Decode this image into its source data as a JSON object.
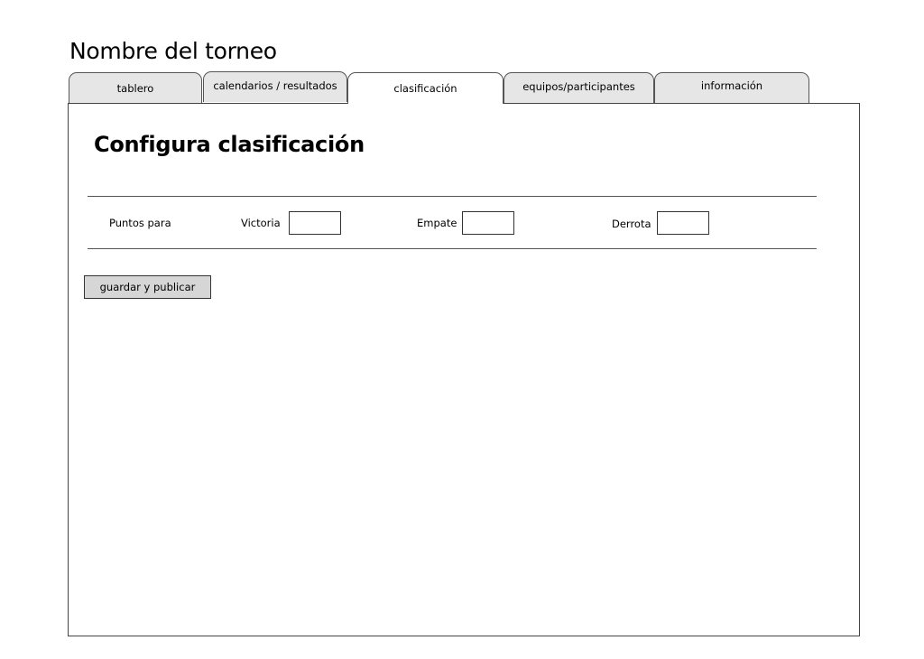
{
  "header": {
    "title": "Nombre del torneo"
  },
  "tabs": [
    {
      "label": "tablero",
      "active": false
    },
    {
      "label": "calendarios / resultados",
      "active": false
    },
    {
      "label": "clasificación",
      "active": true
    },
    {
      "label": "equipos/participantes",
      "active": false
    },
    {
      "label": "información",
      "active": false
    }
  ],
  "main": {
    "section_title": "Configura clasificación",
    "points_label": "Puntos para",
    "fields": [
      {
        "label": "Victoria",
        "value": ""
      },
      {
        "label": "Empate",
        "value": ""
      },
      {
        "label": "Derrota",
        "value": ""
      }
    ],
    "save_label": "guardar y publicar"
  }
}
